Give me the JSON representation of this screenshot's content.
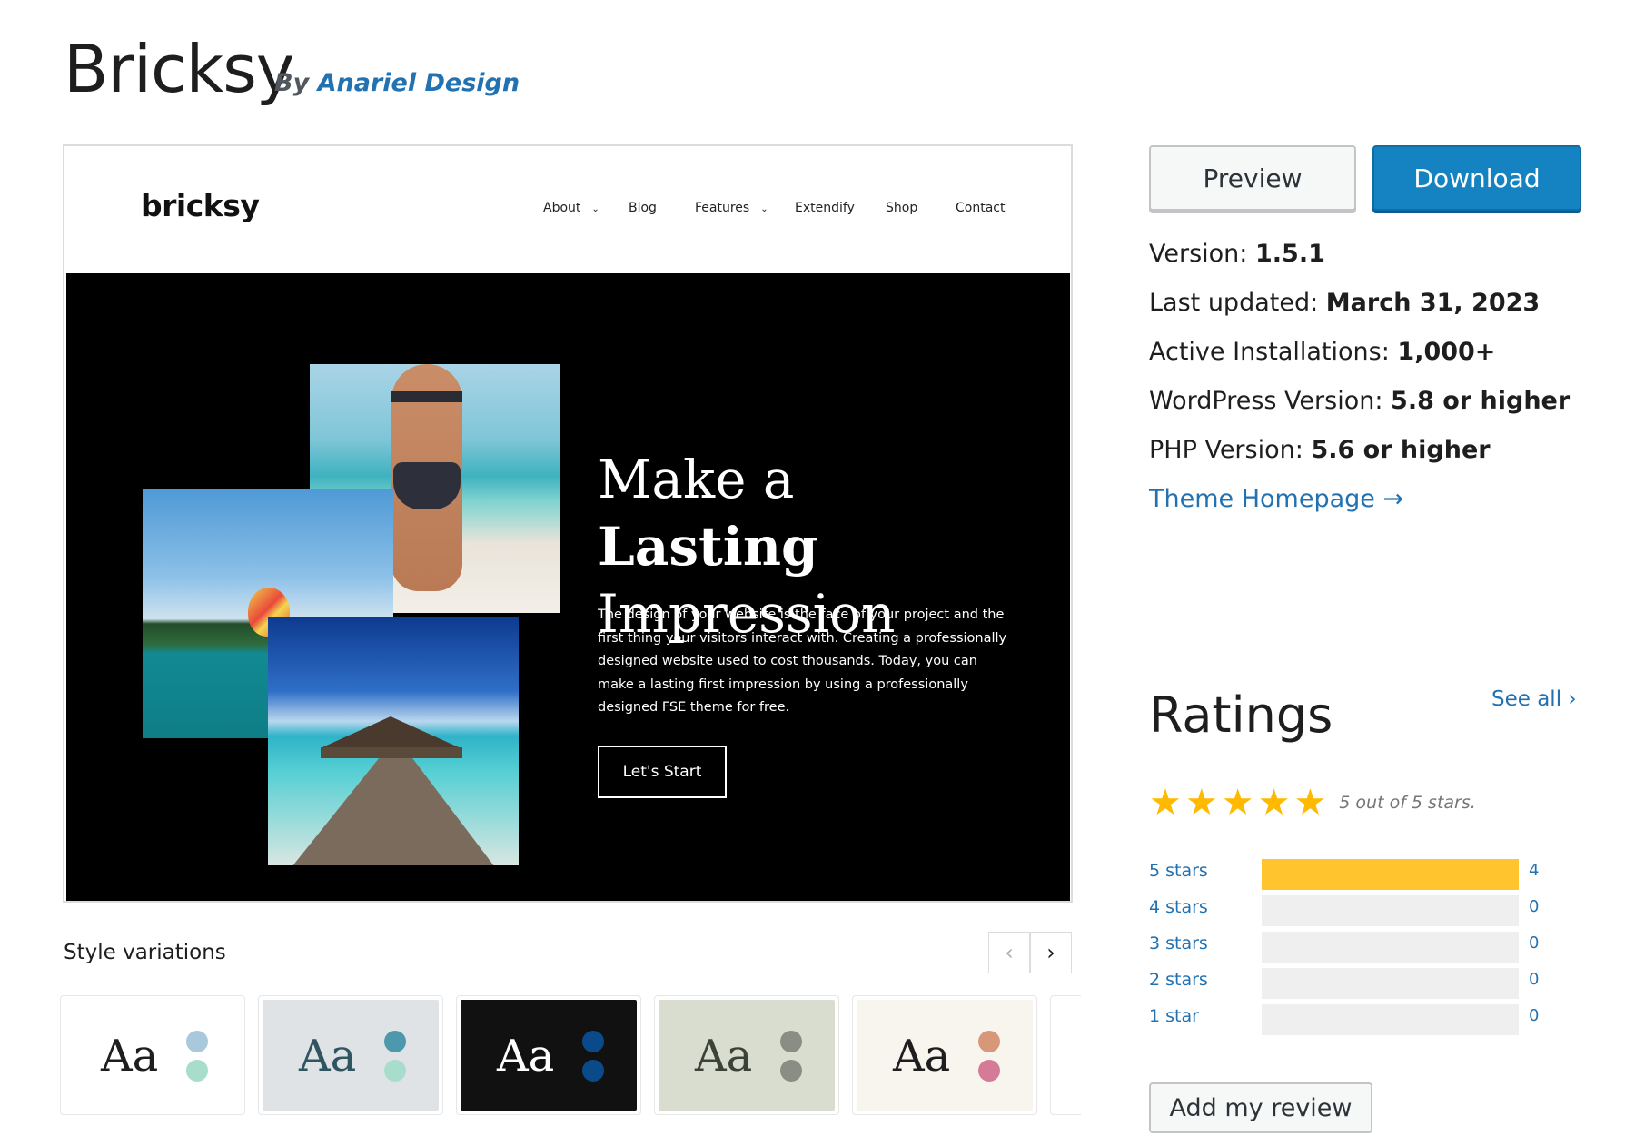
{
  "theme": {
    "name": "Bricksy",
    "by_prefix": "By",
    "author": "Anariel Design"
  },
  "screenshot": {
    "logo": "bricksy",
    "nav": [
      {
        "label": "About",
        "has_dropdown": true
      },
      {
        "label": "Blog",
        "has_dropdown": false
      },
      {
        "label": "Features",
        "has_dropdown": true
      },
      {
        "label": "Extendify",
        "has_dropdown": false
      },
      {
        "label": "Shop",
        "has_dropdown": false
      },
      {
        "label": "Contact",
        "has_dropdown": false
      }
    ],
    "hero": {
      "title_prefix": "Make a",
      "title_bold": "Lasting",
      "title_line2": "Impression",
      "text": "The design of your website is the face of your project and the first thing your visitors interact with. Creating a professionally designed website used to cost thousands. Today, you can make a lasting first impression by using a professionally designed FSE theme for free.",
      "button": "Let's Start"
    }
  },
  "style_variations": {
    "label": "Style variations",
    "sample_text": "Aa",
    "cards": [
      {
        "bg": "#ffffff",
        "text": "#1e1e1e",
        "dot1": "#a9c8dc",
        "dot2": "#a8dccb"
      },
      {
        "bg": "#dfe3e6",
        "text": "#2f5560",
        "dot1": "#4e98ad",
        "dot2": "#a8dccb"
      },
      {
        "bg": "#111111",
        "text": "#ffffff",
        "dot1": "#0b4a8a",
        "dot2": "#0b4a8a"
      },
      {
        "bg": "#d9ddd0",
        "text": "#3c4238",
        "dot1": "#8a8d84",
        "dot2": "#8a8d84"
      },
      {
        "bg": "#f8f5ef",
        "text": "#1e1e1e",
        "dot1": "#d7987a",
        "dot2": "#d57b98"
      }
    ]
  },
  "actions": {
    "preview": "Preview",
    "download": "Download"
  },
  "meta": [
    {
      "label": "Version:",
      "value": "1.5.1"
    },
    {
      "label": "Last updated:",
      "value": "March 31, 2023"
    },
    {
      "label": "Active Installations:",
      "value": "1,000+"
    },
    {
      "label": "WordPress Version:",
      "value": "5.8 or higher"
    },
    {
      "label": "PHP Version:",
      "value": "5.6 or higher"
    }
  ],
  "theme_homepage": "Theme Homepage →",
  "ratings": {
    "title": "Ratings",
    "see_all": "See all",
    "stars_text": "5 out of 5 stars.",
    "star_rating": 5,
    "rows": [
      {
        "label": "5 stars",
        "count": "4",
        "fraction": 1.0
      },
      {
        "label": "4 stars",
        "count": "0",
        "fraction": 0
      },
      {
        "label": "3 stars",
        "count": "0",
        "fraction": 0
      },
      {
        "label": "2 stars",
        "count": "0",
        "fraction": 0
      },
      {
        "label": "1 star",
        "count": "0",
        "fraction": 0
      }
    ],
    "add_review": "Add my review"
  },
  "colors": {
    "accent": "#1582c1",
    "link": "#2271b1",
    "star": "#ffb900",
    "bar": "#ffc42e"
  }
}
